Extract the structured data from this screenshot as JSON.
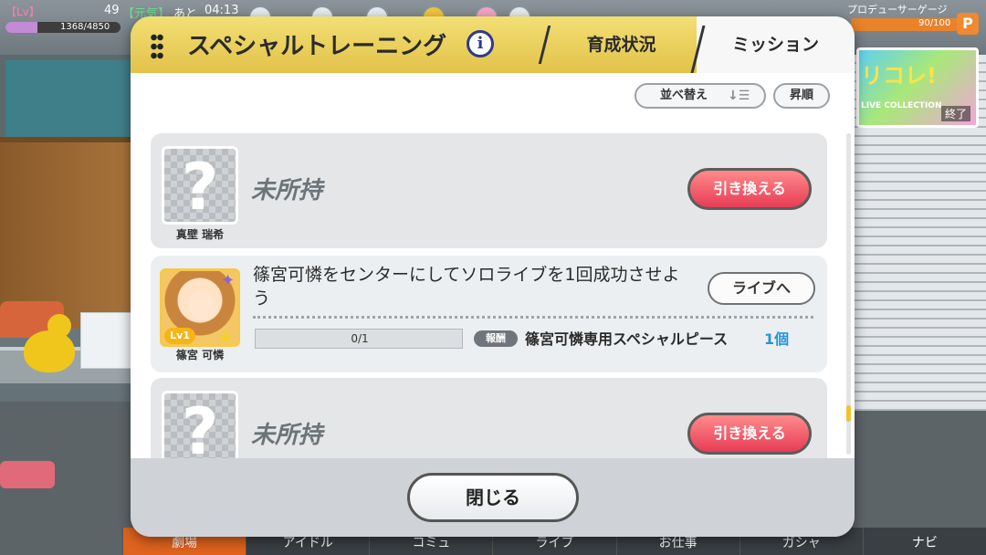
{
  "hud": {
    "lv_tag": "【Lv】",
    "lv_value": "49",
    "genki_label": "【元気】",
    "ato_label": "あと",
    "time_left": "04:13",
    "exp_text": "1368/4850",
    "exp_fraction": 0.28,
    "producer_gauge_label": "プロデューサーゲージ",
    "producer_gauge_value": "90/100",
    "producer_gauge_fraction": 0.9,
    "p_icon": "P"
  },
  "banner": {
    "title": "リコレ!",
    "subtitle": "LIVE COLLECTION",
    "status": "終了"
  },
  "bottom_nav": [
    {
      "label": "劇場"
    },
    {
      "label": "アイドル"
    },
    {
      "label": "コミュ"
    },
    {
      "label": "ライブ"
    },
    {
      "label": "お仕事"
    },
    {
      "label": "ガシャ"
    },
    {
      "label": "ナビ"
    }
  ],
  "dialog": {
    "title": "スペシャルトレーニング",
    "info_glyph": "i",
    "tabs": {
      "status": "育成状況",
      "mission": "ミッション"
    },
    "sort_label": "並べ替え",
    "sort_icon": "↓☰",
    "order_label": "昇順",
    "cards": [
      {
        "placeholder_glyph": "?",
        "idol_name": "真壁 瑞希",
        "state": "未所持",
        "button": "引き換える"
      },
      {
        "idol_name": "篠宮 可憐",
        "level_badge": "Lv1",
        "mission": "篠宮可憐をセンターにしてソロライブを1回成功させよう",
        "button": "ライブへ",
        "progress_text": "0/1",
        "progress_fraction": 0,
        "reward_tag": "報酬",
        "reward_name": "篠宮可憐専用スペシャルピース",
        "reward_count": "1個"
      },
      {
        "placeholder_glyph": "?",
        "idol_name": "",
        "state": "未所持",
        "button": "引き換える"
      }
    ],
    "close_label": "閉じる"
  },
  "colors": {
    "header_gold": "#e2c24a",
    "exchange_red": "#e73c55",
    "reward_blue": "#2795d8",
    "scroll_thumb": "#f0c32d",
    "nav_active": "#e0631e"
  }
}
